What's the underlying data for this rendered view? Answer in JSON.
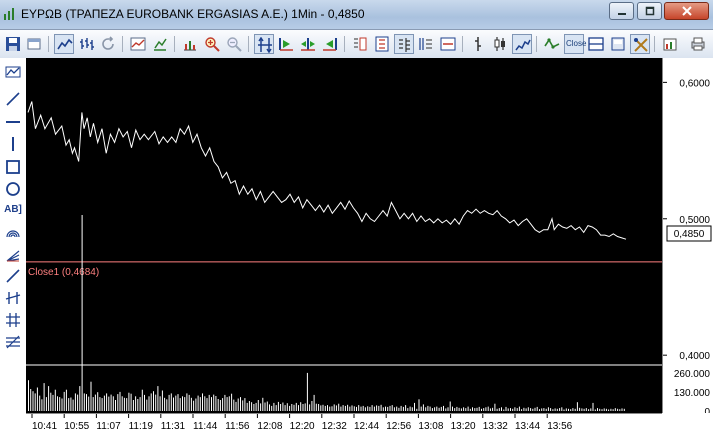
{
  "window": {
    "title": "ΕΥΡΩΒ (ΤΡΑΠΕΖΑ EUROBANK ERGASIAS A.E.) 1Min - 0,4850",
    "buttons": [
      "minimize",
      "maximize",
      "close"
    ]
  },
  "toolbar": {
    "close_button_label": "Close",
    "icons": [
      "save-icon",
      "window-icon",
      "line-chart-icon",
      "ohlc-bars-icon",
      "refresh-icon",
      "indicator-icon",
      "scale-icon",
      "add-study-icon",
      "zoom-in-icon",
      "zoom-out-icon",
      "vertical-arrows-icon",
      "scroll-right-icon",
      "scroll-both-icon",
      "scroll-left-icon",
      "numbers-icon",
      "percent-scale-icon",
      "grid-icon",
      "scale-510-icon",
      "bar-icon",
      "candlestick-icon",
      "line-icon",
      "volume-icon",
      "close-button",
      "split-panel-icon",
      "layout-icon",
      "tools-icon",
      "export-icon",
      "print-icon"
    ]
  },
  "sidebar": {
    "tools": [
      "chart-type-icon",
      "line-tool-icon",
      "horizontal-line-icon",
      "vertical-line-icon",
      "rectangle-icon",
      "ellipse-icon",
      "text-tool-icon",
      "arc-tool-icon",
      "fibonacci-fan-icon",
      "trend-line-icon",
      "parallel-lines-icon",
      "grid-lines-icon",
      "fibonacci-icon"
    ],
    "text_tool_label": "AB]"
  },
  "chart_data": [
    {
      "type": "line",
      "series": [],
      "x_time_ticks": [
        "10:41",
        "10:55",
        "11:07",
        "11:19",
        "11:31",
        "11:44",
        "11:56",
        "12:08",
        "12:20",
        "12:32",
        "12:44",
        "12:56",
        "13:08",
        "13:20",
        "13:32",
        "13:44",
        "13:56"
      ],
      "yticks": [
        "0,6000",
        "0,5000",
        "0,4000"
      ],
      "ylim": [
        0.395,
        0.612
      ],
      "current_value_label": "0,4850",
      "current_value": 0.485,
      "reference_line_label": "Close1 (0,4684)",
      "reference_line_value": 0.4684,
      "colors": {
        "line": "#ffffff",
        "reference": "#ff8080",
        "background": "#000000"
      },
      "price_path": [
        [
          0.0,
          0.578
        ],
        [
          1.8,
          0.586
        ],
        [
          3.5,
          0.566
        ],
        [
          6.0,
          0.576
        ],
        [
          8.0,
          0.566
        ],
        [
          11.0,
          0.574
        ],
        [
          13.0,
          0.562
        ],
        [
          16.0,
          0.568
        ],
        [
          18.0,
          0.554
        ],
        [
          19.5,
          0.558
        ],
        [
          21.0,
          0.548
        ],
        [
          22.0,
          0.552
        ],
        [
          24.0,
          0.542
        ],
        [
          25.5,
          0.578
        ],
        [
          26.5,
          0.566
        ],
        [
          28.0,
          0.574
        ],
        [
          29.5,
          0.56
        ],
        [
          31.0,
          0.57
        ],
        [
          33.0,
          0.556
        ],
        [
          35.0,
          0.566
        ],
        [
          37.0,
          0.548
        ],
        [
          39.0,
          0.562
        ],
        [
          41.0,
          0.556
        ],
        [
          43.0,
          0.566
        ],
        [
          45.0,
          0.56
        ],
        [
          47.0,
          0.564
        ],
        [
          49.0,
          0.552
        ],
        [
          51.0,
          0.565
        ],
        [
          53.0,
          0.558
        ],
        [
          55.0,
          0.562
        ],
        [
          57.0,
          0.558
        ],
        [
          60.0,
          0.564
        ],
        [
          62.0,
          0.555
        ],
        [
          64.0,
          0.56
        ],
        [
          66.0,
          0.556
        ],
        [
          68.0,
          0.56
        ],
        [
          70.0,
          0.556
        ],
        [
          72.0,
          0.566
        ],
        [
          74.0,
          0.562
        ],
        [
          76.0,
          0.568
        ],
        [
          78.0,
          0.556
        ],
        [
          80.0,
          0.562
        ],
        [
          82.0,
          0.552
        ],
        [
          84.0,
          0.546
        ],
        [
          86.0,
          0.552
        ],
        [
          88.0,
          0.542
        ],
        [
          90.0,
          0.538
        ],
        [
          92.0,
          0.53
        ],
        [
          94.0,
          0.534
        ],
        [
          96.0,
          0.526
        ],
        [
          98.0,
          0.528
        ],
        [
          100.0,
          0.518
        ],
        [
          102.0,
          0.524
        ],
        [
          104.0,
          0.518
        ],
        [
          106.0,
          0.522
        ],
        [
          108.0,
          0.514
        ],
        [
          110.0,
          0.52
        ],
        [
          112.0,
          0.512
        ],
        [
          114.0,
          0.516
        ],
        [
          116.0,
          0.52
        ],
        [
          118.0,
          0.516
        ],
        [
          120.0,
          0.512
        ],
        [
          122.0,
          0.514
        ],
        [
          124.0,
          0.518
        ],
        [
          126.0,
          0.512
        ],
        [
          128.0,
          0.516
        ],
        [
          130.0,
          0.508
        ],
        [
          132.0,
          0.514
        ],
        [
          134.0,
          0.51
        ],
        [
          136.0,
          0.506
        ],
        [
          138.0,
          0.51
        ],
        [
          140.0,
          0.505
        ],
        [
          142.0,
          0.51
        ],
        [
          144.0,
          0.504
        ],
        [
          146.0,
          0.508
        ],
        [
          148.0,
          0.512
        ],
        [
          150.0,
          0.507
        ],
        [
          152.0,
          0.513
        ],
        [
          154.0,
          0.508
        ],
        [
          156.0,
          0.504
        ],
        [
          158.0,
          0.498
        ],
        [
          160.0,
          0.504
        ],
        [
          162.0,
          0.5
        ],
        [
          164.0,
          0.498
        ],
        [
          166.0,
          0.502
        ],
        [
          168.0,
          0.506
        ],
        [
          170.0,
          0.502
        ],
        [
          172.0,
          0.512
        ],
        [
          174.0,
          0.506
        ],
        [
          176.0,
          0.5
        ],
        [
          178.0,
          0.504
        ],
        [
          180.0,
          0.5
        ],
        [
          182.0,
          0.504
        ],
        [
          184.0,
          0.498
        ],
        [
          186.0,
          0.502
        ],
        [
          188.0,
          0.498
        ],
        [
          190.0,
          0.5
        ],
        [
          192.0,
          0.497
        ],
        [
          194.0,
          0.5
        ],
        [
          196.0,
          0.497
        ],
        [
          198.0,
          0.499
        ],
        [
          200.0,
          0.496
        ],
        [
          202.0,
          0.5
        ],
        [
          204.0,
          0.496
        ],
        [
          206.0,
          0.502
        ],
        [
          208.0,
          0.506
        ],
        [
          210.0,
          0.504
        ],
        [
          212.0,
          0.507
        ],
        [
          214.0,
          0.504
        ],
        [
          216.0,
          0.506
        ],
        [
          218.0,
          0.504
        ],
        [
          220.0,
          0.503
        ],
        [
          222.0,
          0.506
        ],
        [
          224.0,
          0.502
        ],
        [
          226.0,
          0.5
        ],
        [
          228.0,
          0.497
        ],
        [
          230.0,
          0.499
        ],
        [
          232.0,
          0.495
        ],
        [
          234.0,
          0.498
        ],
        [
          236.0,
          0.5
        ],
        [
          238.0,
          0.496
        ],
        [
          240.0,
          0.492
        ],
        [
          242.0,
          0.49
        ],
        [
          244.0,
          0.492
        ],
        [
          246.0,
          0.492
        ],
        [
          248.0,
          0.5
        ],
        [
          249.0,
          0.492
        ],
        [
          251.0,
          0.496
        ],
        [
          253.0,
          0.494
        ],
        [
          255.0,
          0.493
        ],
        [
          257.0,
          0.495
        ],
        [
          259.0,
          0.492
        ],
        [
          261.0,
          0.494
        ],
        [
          263.0,
          0.49
        ],
        [
          265.0,
          0.495
        ],
        [
          267.0,
          0.494
        ],
        [
          269.0,
          0.492
        ],
        [
          271.0,
          0.488
        ],
        [
          273.0,
          0.488
        ],
        [
          275.0,
          0.487
        ],
        [
          277.0,
          0.489
        ],
        [
          279.0,
          0.487
        ],
        [
          281.0,
          0.486
        ],
        [
          283.0,
          0.485
        ]
      ]
    },
    {
      "type": "bar",
      "name": "volume",
      "yticks": [
        "260.000",
        "130.000",
        "0"
      ],
      "ylim": [
        0,
        300000
      ],
      "colors": {
        "bars": "#ffffff"
      },
      "volumes": [
        210000,
        150000,
        135000,
        120000,
        160000,
        105000,
        80000,
        190000,
        95000,
        170000,
        125000,
        110000,
        145000,
        100000,
        95000,
        85000,
        130000,
        145000,
        88000,
        92000,
        78000,
        120000,
        112000,
        170000,
        1050000,
        120000,
        115000,
        98000,
        200000,
        95000,
        112000,
        128000,
        95000,
        88000,
        105000,
        120000,
        98000,
        112000,
        100000,
        75000,
        115000,
        130000,
        100000,
        90000,
        88000,
        125000,
        118000,
        75000,
        100000,
        82000,
        95000,
        145000,
        110000,
        78000,
        100000,
        120000,
        135000,
        112000,
        170000,
        100000,
        140000,
        90000,
        80000,
        110000,
        120000,
        92000,
        105000,
        115000,
        88000,
        100000,
        95000,
        120000,
        110000,
        90000,
        70000,
        85000,
        105000,
        95000,
        120000,
        100000,
        88000,
        110000,
        95000,
        112000,
        102000,
        82000,
        75000,
        88000,
        110000,
        95000,
        100000,
        118000,
        78000,
        62000,
        85000,
        95000,
        72000,
        88000,
        55000,
        68000,
        60000,
        48000,
        55000,
        75000,
        52000,
        90000,
        58000,
        65000,
        45000,
        35000,
        55000,
        40000,
        62000,
        48000,
        58000,
        40000,
        53000,
        35000,
        48000,
        42000,
        55000,
        40000,
        60000,
        48000,
        52000,
        260000,
        45000,
        68000,
        110000,
        50000,
        48000,
        38000,
        42000,
        35000,
        40000,
        30000,
        32000,
        45000,
        38000,
        50000,
        30000,
        40000,
        35000,
        42000,
        30000,
        38000,
        32000,
        28000,
        40000,
        30000,
        35000,
        25000,
        32000,
        28000,
        40000,
        30000,
        38000,
        35000,
        42000,
        25000,
        30000,
        28000,
        35000,
        40000,
        25000,
        30000,
        22000,
        35000,
        28000,
        40000,
        20000,
        30000,
        25000,
        55000,
        15000,
        80000,
        30000,
        45000,
        25000,
        35000,
        30000,
        20000,
        25000,
        30000,
        22000,
        28000,
        35000,
        18000,
        25000,
        65000,
        30000,
        20000,
        28000,
        22000,
        18000,
        25000,
        20000,
        30000,
        15000,
        25000,
        20000,
        22000,
        28000,
        15000,
        20000,
        25000,
        30000,
        18000,
        22000,
        50000,
        15000,
        20000,
        25000,
        10000,
        28000,
        18000,
        20000,
        15000,
        25000,
        20000,
        30000,
        12000,
        22000,
        18000,
        25000,
        20000,
        15000,
        22000,
        28000,
        12000,
        18000,
        20000,
        15000,
        25000,
        20000,
        12000,
        18000,
        15000,
        20000,
        25000,
        10000,
        18000,
        15000,
        12000,
        20000,
        15000,
        60000,
        22000,
        18000,
        15000,
        20000,
        12000,
        18000,
        55000,
        10000,
        20000,
        15000,
        12000,
        18000,
        15000,
        10000,
        15000,
        12000,
        20000,
        15000,
        12000,
        18000,
        15000
      ]
    }
  ]
}
